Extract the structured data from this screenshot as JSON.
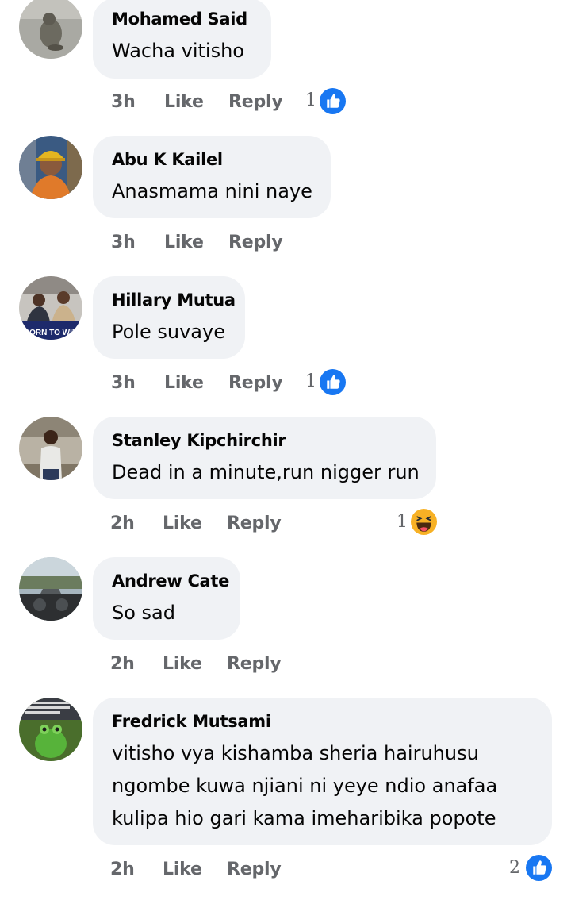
{
  "comments": [
    {
      "author": "Mohamed Said",
      "text": "Wacha vitisho",
      "time": "3h",
      "like": "Like",
      "reply": "Reply",
      "reaction_count": "1",
      "reaction": "like-icon"
    },
    {
      "author": "Abu K Kailel",
      "text": "Anasmama nini naye",
      "time": "3h",
      "like": "Like",
      "reply": "Reply",
      "reaction_count": "",
      "reaction": ""
    },
    {
      "author": "Hillary Mutua",
      "text": "Pole suvaye",
      "time": "3h",
      "like": "Like",
      "reply": "Reply",
      "reaction_count": "1",
      "reaction": "like-icon"
    },
    {
      "author": "Stanley Kipchirchir",
      "text": "Dead in a minute,run nigger run",
      "time": "2h",
      "like": "Like",
      "reply": "Reply",
      "reaction_count": "1",
      "reaction": "haha-icon"
    },
    {
      "author": "Andrew Cate",
      "text": "So sad",
      "time": "2h",
      "like": "Like",
      "reply": "Reply",
      "reaction_count": "",
      "reaction": ""
    },
    {
      "author": "Fredrick Mutsami",
      "text": "vitisho vya kishamba sheria hairuhusu\nngombe kuwa njiani ni yeye ndio anafaa\nkulipa hio gari kama imeharibika popote",
      "time": "2h",
      "like": "Like",
      "reply": "Reply",
      "reaction_count": "2",
      "reaction": "like-icon"
    }
  ],
  "avatar_badges": {
    "hillary": "BORN TO WIN"
  },
  "colors": {
    "bubble": "#f0f2f5",
    "meta": "#65676b",
    "like_blue": "#1877f2",
    "haha_yellow": "#f7b125"
  }
}
